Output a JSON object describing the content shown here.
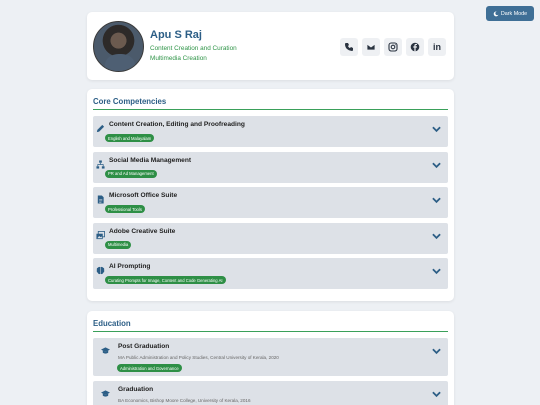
{
  "dark_mode_label": "Dark Mode",
  "profile": {
    "name": "Apu S Raj",
    "subtitle1": "Content Creation and Curation",
    "subtitle2": "Multimedia Creation",
    "contact_icons": [
      "phone-icon",
      "email-icon",
      "instagram-icon",
      "facebook-icon",
      "linkedin-icon"
    ]
  },
  "competencies": {
    "title": "Core Competencies",
    "items": [
      {
        "label": "Content Creation, Editing and Proofreading",
        "tag": "English and Malayalam",
        "icon": "pencil-icon"
      },
      {
        "label": "Social Media Management",
        "tag": "PR and Ad Management",
        "icon": "network-icon"
      },
      {
        "label": "Microsoft Office Suite",
        "tag": "Professional Tools",
        "icon": "document-icon"
      },
      {
        "label": "Adobe Creative Suite",
        "tag": "Multimedia",
        "icon": "images-icon"
      },
      {
        "label": "AI Prompting",
        "tag": "Curating Prompts for Image, Content and Code Generating AI",
        "icon": "brain-icon"
      }
    ]
  },
  "education": {
    "title": "Education",
    "items": [
      {
        "label": "Post Graduation",
        "detail": "MA Public Administration and Policy Studies, Central University of Kerala, 2020",
        "tag": "Administration and Governance",
        "icon": "graduation-cap-icon"
      },
      {
        "label": "Graduation",
        "detail": "BA Economics, Bishop Moore College, University of Kerala, 2016",
        "tag": "",
        "icon": "graduation-cap-icon"
      }
    ]
  },
  "colors": {
    "accent": "#2c5e86",
    "green": "#2e8f46",
    "button": "#3f6f96"
  }
}
